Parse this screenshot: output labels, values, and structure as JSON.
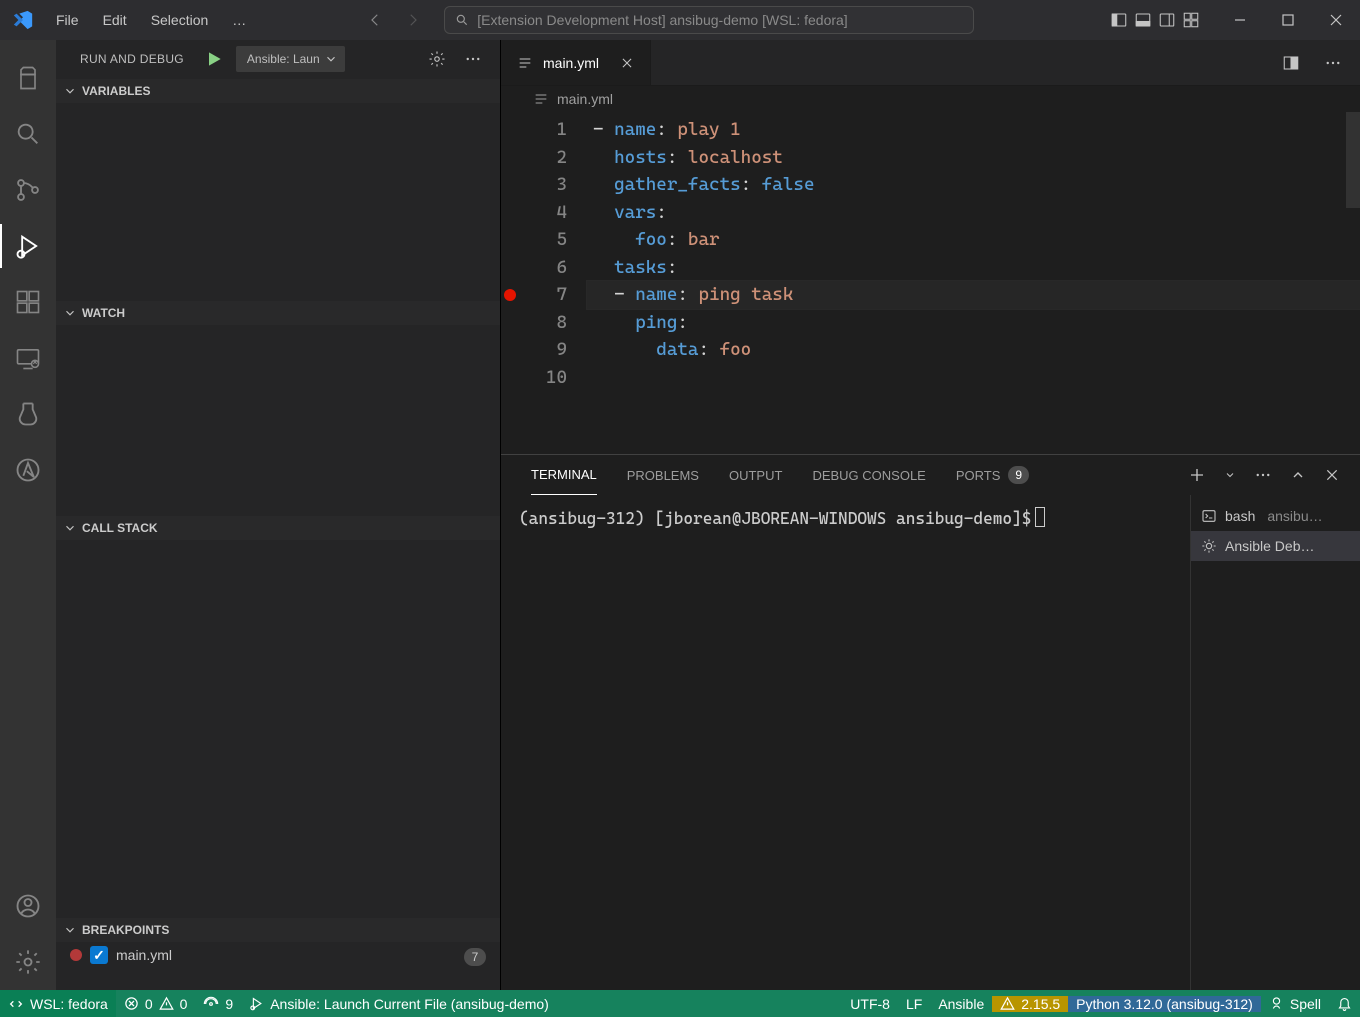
{
  "titlebar": {
    "menus": [
      "File",
      "Edit",
      "Selection",
      "…"
    ],
    "search": "[Extension Development Host] ansibug-demo [WSL: fedora]"
  },
  "activity": {
    "items": [
      "explorer",
      "search",
      "scm",
      "debug",
      "extensions",
      "remote",
      "testing",
      "ansible"
    ]
  },
  "debug": {
    "title": "RUN AND DEBUG",
    "config": "Ansible: Laun",
    "sections": {
      "variables": "VARIABLES",
      "watch": "WATCH",
      "callstack": "CALL STACK",
      "breakpoints": "BREAKPOINTS"
    },
    "breakpoints": [
      {
        "file": "main.yml",
        "count": "7",
        "color": "#b33939"
      }
    ]
  },
  "editor": {
    "tab": {
      "file": "main.yml"
    },
    "breadcrumb": "main.yml",
    "lines": [
      [
        {
          "t": "- ",
          "c": "p"
        },
        {
          "t": "name",
          "c": "k"
        },
        {
          "t": ": ",
          "c": "p"
        },
        {
          "t": "play 1",
          "c": "s"
        }
      ],
      [
        {
          "t": "  ",
          "c": "p"
        },
        {
          "t": "hosts",
          "c": "k"
        },
        {
          "t": ": ",
          "c": "p"
        },
        {
          "t": "localhost",
          "c": "s"
        }
      ],
      [
        {
          "t": "  ",
          "c": "p"
        },
        {
          "t": "gather_facts",
          "c": "k"
        },
        {
          "t": ": ",
          "c": "p"
        },
        {
          "t": "false",
          "c": "b"
        }
      ],
      [
        {
          "t": "  ",
          "c": "p"
        },
        {
          "t": "vars",
          "c": "k"
        },
        {
          "t": ":",
          "c": "p"
        }
      ],
      [
        {
          "t": "    ",
          "c": "p"
        },
        {
          "t": "foo",
          "c": "k"
        },
        {
          "t": ": ",
          "c": "p"
        },
        {
          "t": "bar",
          "c": "s"
        }
      ],
      [
        {
          "t": "  ",
          "c": "p"
        },
        {
          "t": "tasks",
          "c": "k"
        },
        {
          "t": ":",
          "c": "p"
        }
      ],
      [
        {
          "t": "  - ",
          "c": "p"
        },
        {
          "t": "name",
          "c": "k"
        },
        {
          "t": ": ",
          "c": "p"
        },
        {
          "t": "ping task",
          "c": "s"
        }
      ],
      [
        {
          "t": "    ",
          "c": "p"
        },
        {
          "t": "ping",
          "c": "k"
        },
        {
          "t": ":",
          "c": "p"
        }
      ],
      [
        {
          "t": "      ",
          "c": "p"
        },
        {
          "t": "data",
          "c": "k"
        },
        {
          "t": ": ",
          "c": "p"
        },
        {
          "t": "foo",
          "c": "s"
        }
      ],
      []
    ],
    "breakpoint_line": 7,
    "current_line": 7
  },
  "panel": {
    "tabs": {
      "terminal": "TERMINAL",
      "problems": "PROBLEMS",
      "output": "OUTPUT",
      "debug": "DEBUG CONSOLE",
      "ports": "PORTS",
      "ports_badge": "9"
    },
    "prompt": "(ansibug-312) [jborean@JBOREAN-WINDOWS ansibug-demo]$",
    "terms": [
      {
        "name": "bash",
        "sub": "ansibu…"
      },
      {
        "name": "Ansible Deb…",
        "sub": ""
      }
    ]
  },
  "status": {
    "remote": "WSL: fedora",
    "errors": "0",
    "warnings": "0",
    "ports": "9",
    "launch": "Ansible: Launch Current File (ansibug-demo)",
    "encoding": "UTF-8",
    "eol": "LF",
    "lang": "Ansible",
    "lint": "2.15.5",
    "python": "Python 3.12.0 (ansibug-312)",
    "spell": "Spell"
  }
}
